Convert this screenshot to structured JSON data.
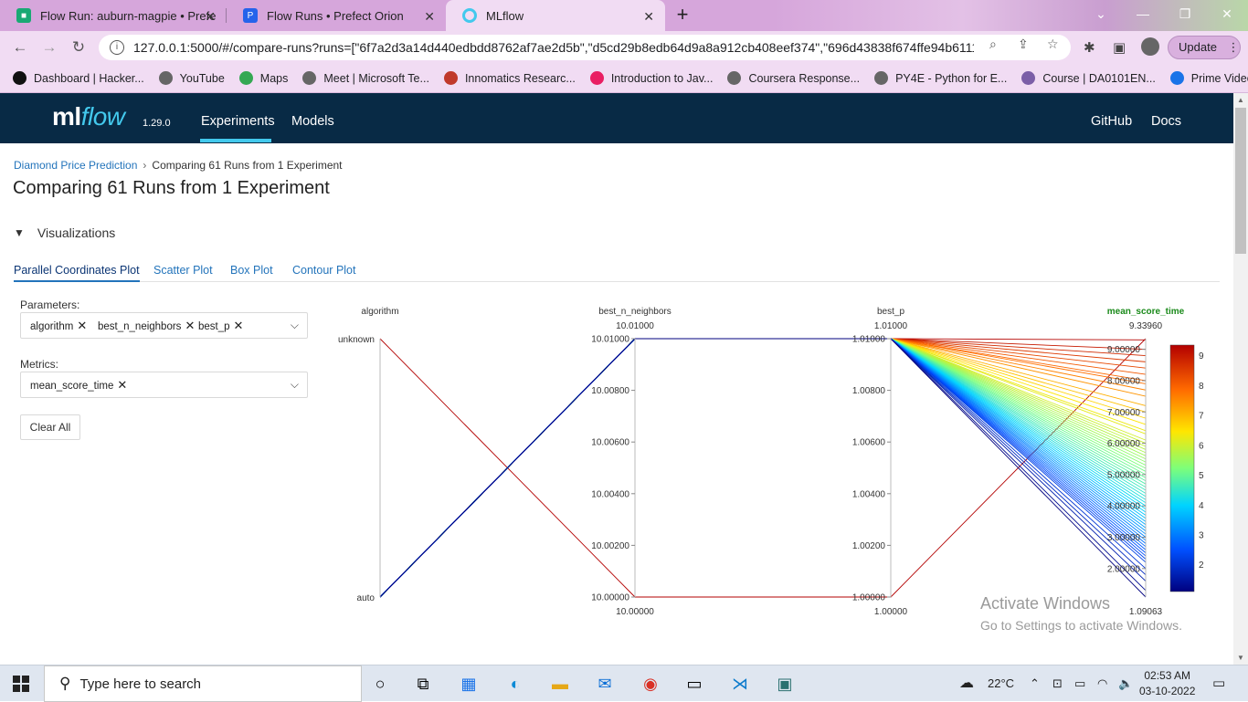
{
  "browser": {
    "tabs": [
      {
        "title": "Flow Run: auburn-magpie • Prefe",
        "favicon_color": "#19a974"
      },
      {
        "title": "Flow Runs • Prefect Orion",
        "favicon_color": "#2563eb"
      },
      {
        "title": "MLflow",
        "favicon_color": "#43c9ed"
      }
    ],
    "url": "127.0.0.1:5000/#/compare-runs?runs=[\"6f7a2d3a14d440edbdd8762af7ae2d5b\",\"d5cd29b8edb64d9a8a912cb408eef374\",\"696d43838f674ffe94b6111...",
    "update_label": "Update",
    "bookmarks": [
      {
        "label": "Dashboard | Hacker...",
        "color": "#111111"
      },
      {
        "label": "YouTube",
        "color": "#666666"
      },
      {
        "label": "Maps",
        "color": "#34a853"
      },
      {
        "label": "Meet | Microsoft Te...",
        "color": "#666666"
      },
      {
        "label": "Innomatics Researc...",
        "color": "#c0392b"
      },
      {
        "label": "Introduction to Jav...",
        "color": "#e91e63"
      },
      {
        "label": "Coursera Response...",
        "color": "#666666"
      },
      {
        "label": "PY4E - Python for E...",
        "color": "#666666"
      },
      {
        "label": "Course | DA0101EN...",
        "color": "#7b5ea7"
      },
      {
        "label": "Prime Video",
        "color": "#1a73e8"
      }
    ]
  },
  "mlflow": {
    "logo_ml": "ml",
    "logo_flow": "flow",
    "version": "1.29.0",
    "nav": {
      "experiments": "Experiments",
      "models": "Models",
      "github": "GitHub",
      "docs": "Docs"
    }
  },
  "page": {
    "breadcrumb_parent": "Diamond Price Prediction",
    "breadcrumb_sep": "›",
    "breadcrumb_current": "Comparing 61 Runs from 1 Experiment",
    "title": "Comparing 61 Runs from 1 Experiment",
    "section": "Visualizations",
    "plot_tabs": [
      "Parallel Coordinates Plot",
      "Scatter Plot",
      "Box Plot",
      "Contour Plot"
    ],
    "parameters_label": "Parameters:",
    "parameters": [
      "algorithm",
      "best_n_neighbors",
      "best_p"
    ],
    "metrics_label": "Metrics:",
    "metrics": [
      "mean_score_time"
    ],
    "clear_all": "Clear All"
  },
  "chart_data": {
    "type": "parallel_coordinates",
    "axes": [
      {
        "name": "algorithm",
        "categorical": true,
        "ticks": [
          "unknown",
          "auto"
        ]
      },
      {
        "name": "best_n_neighbors",
        "top_label": "10.01000",
        "bottom_label": "10.00000",
        "range": [
          10.0,
          10.01
        ],
        "ticks": [
          "10.01000",
          "10.00800",
          "10.00600",
          "10.00400",
          "10.00200",
          "10.00000"
        ]
      },
      {
        "name": "best_p",
        "top_label": "1.01000",
        "bottom_label": "1.00000",
        "range": [
          1.0,
          1.01
        ],
        "ticks": [
          "1.01000",
          "1.00800",
          "1.00600",
          "1.00400",
          "1.00200",
          "1.00000"
        ]
      },
      {
        "name": "mean_score_time",
        "highlighted": true,
        "top_label": "9.33960",
        "bottom_label": "1.09063",
        "range": [
          1.09063,
          9.3396
        ],
        "ticks": [
          "9.00000",
          "8.00000",
          "7.00000",
          "6.00000",
          "5.00000",
          "4.00000",
          "3.00000",
          "2.00000"
        ]
      }
    ],
    "lines": [
      {
        "algorithm": "unknown",
        "best_n_neighbors": 10.0,
        "best_p": 1.0,
        "mean_score_time": 9.3396
      },
      {
        "algorithm": "auto",
        "best_n_neighbors": 10.01,
        "best_p": 1.01,
        "mean_score_time": [
          9.3,
          9.0,
          8.8,
          8.6,
          8.4,
          8.2,
          8.0,
          7.9,
          7.7,
          7.5,
          7.2,
          7.0,
          6.8,
          6.6,
          6.4,
          6.3,
          6.1,
          6.0,
          5.9,
          5.8,
          5.7,
          5.6,
          5.5,
          5.4,
          5.3,
          5.2,
          5.1,
          5.0,
          4.9,
          4.8,
          4.7,
          4.6,
          4.5,
          4.4,
          4.3,
          4.2,
          4.1,
          4.0,
          3.9,
          3.8,
          3.7,
          3.6,
          3.5,
          3.4,
          3.3,
          3.2,
          3.1,
          3.0,
          2.9,
          2.8,
          2.7,
          2.6,
          2.5,
          2.4,
          2.3,
          2.2,
          2.0,
          1.8,
          1.6,
          1.3,
          1.09063
        ]
      }
    ],
    "colorbar": {
      "ticks": [
        "9",
        "8",
        "7",
        "6",
        "5",
        "4",
        "3",
        "2"
      ],
      "range": [
        1.09063,
        9.3396
      ],
      "colorscale": [
        "#00007f",
        "#0050ff",
        "#00d4ff",
        "#7dff7a",
        "#ffe600",
        "#ff6a00",
        "#b30000"
      ]
    }
  },
  "watermark": {
    "line1": "Activate Windows",
    "line2": "Go to Settings to activate Windows."
  },
  "taskbar": {
    "search_placeholder": "Type here to search",
    "weather": "22°C",
    "time": "02:53 AM",
    "date": "03-10-2022"
  }
}
